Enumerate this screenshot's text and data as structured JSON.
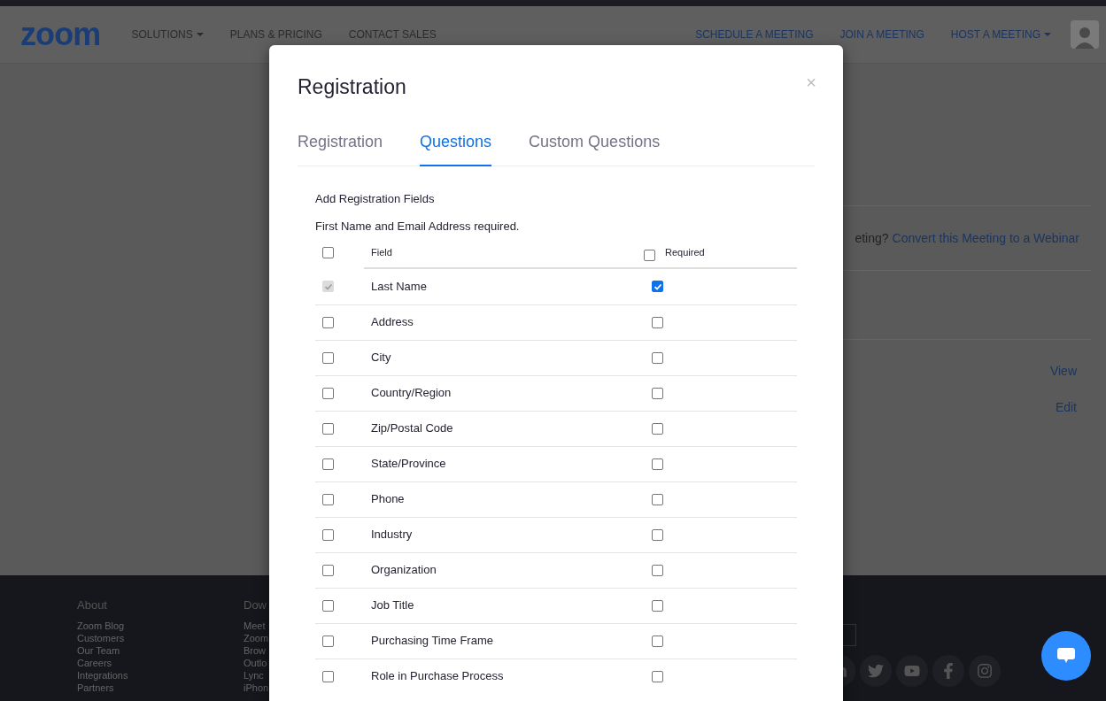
{
  "header": {
    "logo": "zoom",
    "nav_left": [
      {
        "label": "SOLUTIONS",
        "dropdown": true
      },
      {
        "label": "PLANS & PRICING",
        "dropdown": false
      },
      {
        "label": "CONTACT SALES",
        "dropdown": false
      }
    ],
    "nav_right": [
      {
        "label": "SCHEDULE A MEETING",
        "dropdown": false
      },
      {
        "label": "JOIN A MEETING",
        "dropdown": false
      },
      {
        "label": "HOST A MEETING",
        "dropdown": true
      }
    ]
  },
  "background": {
    "question_partial": "eting?",
    "convert_link": "Convert this Meeting to a Webinar",
    "actions": [
      "View",
      "Edit"
    ]
  },
  "footer": {
    "columns": [
      {
        "heading": "About",
        "links": [
          "Zoom Blog",
          "Customers",
          "Our Team",
          "Careers",
          "Integrations",
          "Partners"
        ]
      },
      {
        "heading": "Dow",
        "links": [
          "Meet",
          "Zoom",
          "Brow",
          "Outlo",
          "Lync",
          "iPhon"
        ]
      }
    ]
  },
  "modal": {
    "title": "Registration",
    "close": "×",
    "tabs": [
      {
        "label": "Registration",
        "selected": false
      },
      {
        "label": "Questions",
        "selected": true
      },
      {
        "label": "Custom Questions",
        "selected": false
      }
    ],
    "heading": "Add Registration Fields",
    "note": "First Name and Email Address required.",
    "table": {
      "columns": [
        "Field",
        "Required"
      ],
      "all_included": false,
      "all_required": false,
      "rows": [
        {
          "field": "Last Name",
          "included": true,
          "disabled": true,
          "required": true
        },
        {
          "field": "Address",
          "included": false,
          "disabled": false,
          "required": false
        },
        {
          "field": "City",
          "included": false,
          "disabled": false,
          "required": false
        },
        {
          "field": "Country/Region",
          "included": false,
          "disabled": false,
          "required": false
        },
        {
          "field": "Zip/Postal Code",
          "included": false,
          "disabled": false,
          "required": false
        },
        {
          "field": "State/Province",
          "included": false,
          "disabled": false,
          "required": false
        },
        {
          "field": "Phone",
          "included": false,
          "disabled": false,
          "required": false
        },
        {
          "field": "Industry",
          "included": false,
          "disabled": false,
          "required": false
        },
        {
          "field": "Organization",
          "included": false,
          "disabled": false,
          "required": false
        },
        {
          "field": "Job Title",
          "included": false,
          "disabled": false,
          "required": false
        },
        {
          "field": "Purchasing Time Frame",
          "included": false,
          "disabled": false,
          "required": false
        },
        {
          "field": "Role in Purchase Process",
          "included": false,
          "disabled": false,
          "required": false
        }
      ]
    }
  }
}
